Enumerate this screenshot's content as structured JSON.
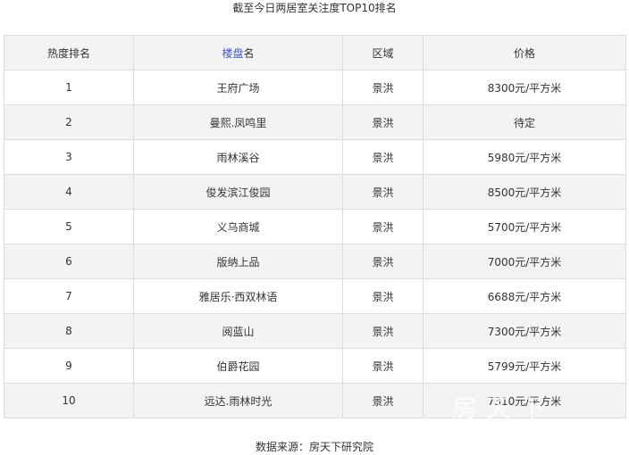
{
  "caption": "截至今日两居室关注度TOP10排名",
  "table": {
    "headers": {
      "rank": "热度排名",
      "name_link": "楼盘",
      "name_suffix": "名",
      "area": "区域",
      "price": "价格"
    },
    "rows": [
      {
        "rank": "1",
        "name": "王府广场",
        "area": "景洪",
        "price": "8300元/平方米"
      },
      {
        "rank": "2",
        "name": "曼熙.凤鸣里",
        "area": "景洪",
        "price": "待定"
      },
      {
        "rank": "3",
        "name": "雨林溪谷",
        "area": "景洪",
        "price": "5980元/平方米"
      },
      {
        "rank": "4",
        "name": "俊发滨江俊园",
        "area": "景洪",
        "price": "8500元/平方米"
      },
      {
        "rank": "5",
        "name": "义乌商城",
        "area": "景洪",
        "price": "5700元/平方米"
      },
      {
        "rank": "6",
        "name": "版纳上品",
        "area": "景洪",
        "price": "7000元/平方米"
      },
      {
        "rank": "7",
        "name": "雅居乐·西双林语",
        "area": "景洪",
        "price": "6688元/平方米"
      },
      {
        "rank": "8",
        "name": "阅蓝山",
        "area": "景洪",
        "price": "7300元/平方米"
      },
      {
        "rank": "9",
        "name": "伯爵花园",
        "area": "景洪",
        "price": "5799元/平方米"
      },
      {
        "rank": "10",
        "name": "远达.雨林时光",
        "area": "景洪",
        "price": "7310元/平方米"
      }
    ]
  },
  "source": "数据来源：房天下研究院",
  "watermark": "房天下"
}
